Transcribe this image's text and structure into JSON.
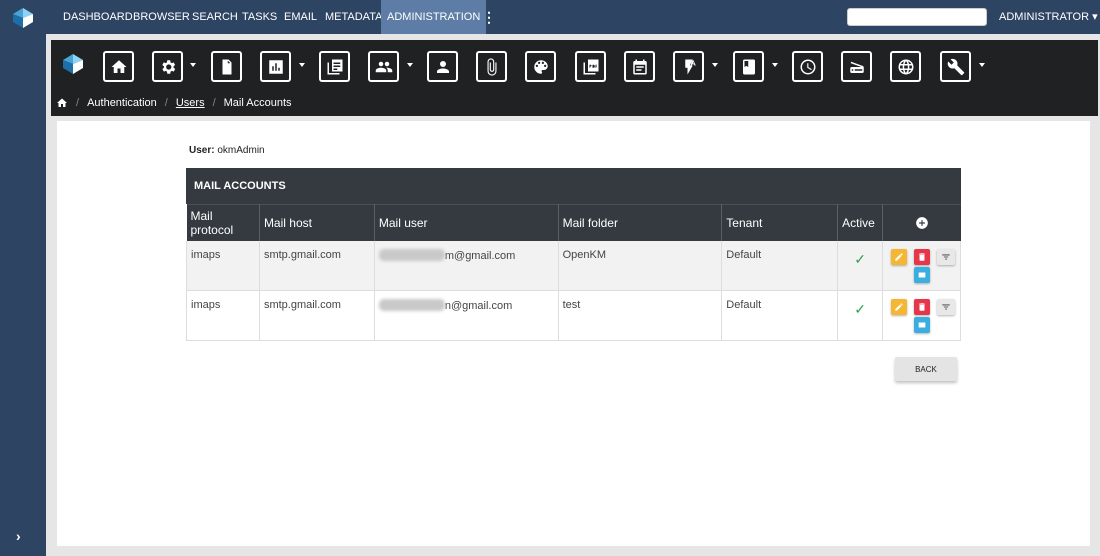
{
  "topnav": {
    "items": [
      "DASHBOARD",
      "BROWSER",
      "SEARCH",
      "TASKS",
      "EMAIL",
      "METADATA",
      "ADMINISTRATION"
    ],
    "active": "ADMINISTRATION",
    "search_placeholder": "",
    "user_menu": "ADMINISTRATOR ▾"
  },
  "toolbar": {
    "icons": [
      "home-icon",
      "settings-icon",
      "document-icon",
      "report-icon",
      "list-icon",
      "group-icon",
      "user-icon",
      "attachment-icon",
      "palette-icon",
      "pdf-icon",
      "calendar-icon",
      "automation-icon",
      "book-icon",
      "clock-icon",
      "scanner-icon",
      "globe-icon",
      "wrench-icon"
    ]
  },
  "breadcrumb": {
    "items": [
      "Authentication",
      "Users",
      "Mail Accounts"
    ]
  },
  "user_line": {
    "label": "User:",
    "value": "okmAdmin"
  },
  "card": {
    "title": "MAIL ACCOUNTS",
    "columns": [
      "Mail protocol",
      "Mail host",
      "Mail user",
      "Mail folder",
      "Tenant",
      "Active"
    ],
    "rows": [
      {
        "protocol": "imaps",
        "host": "smtp.gmail.com",
        "user_suffix": "m@gmail.com",
        "folder": "OpenKM",
        "tenant": "Default",
        "active": "✓"
      },
      {
        "protocol": "imaps",
        "host": "smtp.gmail.com",
        "user_suffix": "n@gmail.com",
        "folder": "test",
        "tenant": "Default",
        "active": "✓"
      }
    ]
  },
  "back_label": "BACK",
  "colors": {
    "nav": "#2e4463",
    "active": "#5d7da6",
    "toolbar": "#1f2122",
    "edit": "#f5b731",
    "delete": "#e53749",
    "mail": "#3aaee0",
    "check": "#2ca24a"
  }
}
